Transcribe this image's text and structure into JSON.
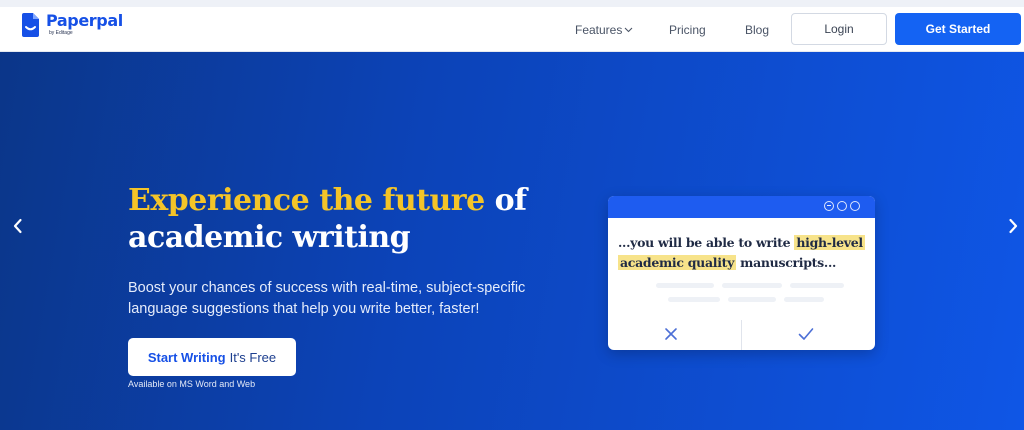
{
  "brand": {
    "name": "Paperpal",
    "byline": "by Editage",
    "color": "#1650e6"
  },
  "nav": {
    "features": "Features",
    "pricing": "Pricing",
    "blog": "Blog",
    "login": "Login",
    "get_started": "Get Started"
  },
  "hero": {
    "headline_accent": "Experience the future",
    "headline_rest": "of",
    "headline_line2": "academic writing",
    "subtext": "Boost your chances of success with real-time, subject-specific language suggestions that help you write better, faster!",
    "start_main": "Start Writing",
    "start_free": "It's Free",
    "available": "Available on MS Word and Web",
    "background_start": "#0b3689",
    "background_end": "#0f56e6",
    "accent_color": "#f4c428"
  },
  "card": {
    "text_before": "...you will be able to write ",
    "text_highlight_1": "high-level",
    "text_highlight_2": "academic quality",
    "text_after": " manuscripts...",
    "highlight_color": "#f7e38a"
  },
  "icons": {
    "logo": "paperpal-logo-icon",
    "features_caret": "chevron-down-icon",
    "prev": "chevron-left-icon",
    "next": "chevron-right-icon",
    "reject": "close-icon",
    "accept": "check-icon"
  }
}
